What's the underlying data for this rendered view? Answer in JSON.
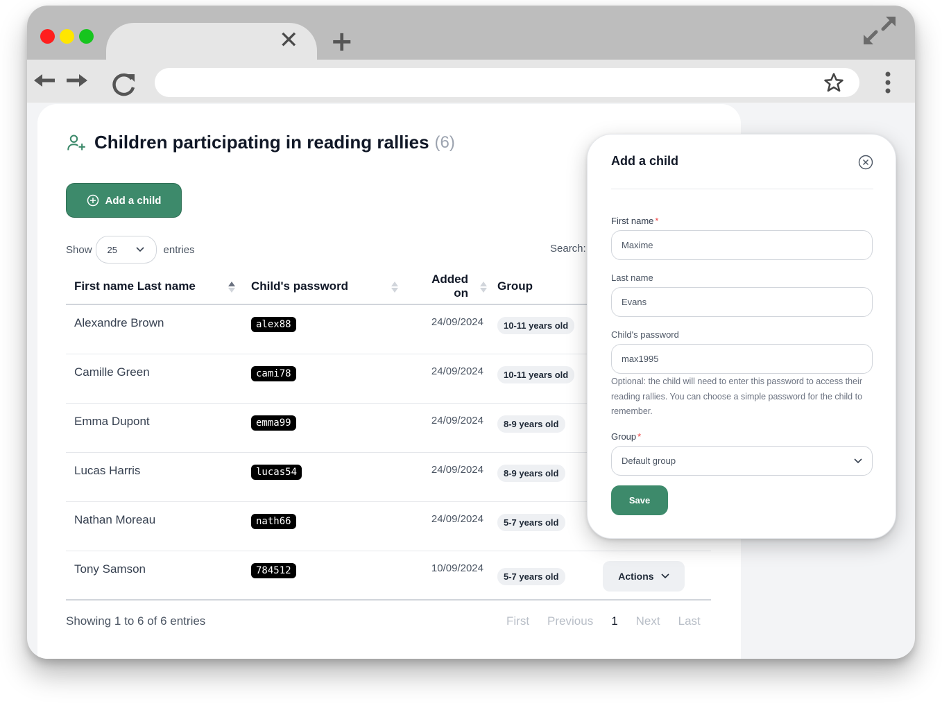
{
  "browser": {
    "tab_close_glyph": "✕",
    "tab_new_glyph": "+",
    "icons": [
      "fullscreen-icon",
      "back-arrow-icon",
      "forward-arrow-icon",
      "reload-icon",
      "star-icon",
      "kebab-menu-icon"
    ]
  },
  "page": {
    "title": "Children participating in reading rallies",
    "title_count": "(6)",
    "title_icon": "user-add-icon",
    "add_button_label": "Add a child",
    "show_label": "Show",
    "entries_value": "25",
    "entries_label": "entries",
    "search_label": "Search:"
  },
  "table": {
    "headers": [
      "First name Last name",
      "Child's password",
      "Added on",
      "Group"
    ],
    "rows": [
      {
        "name": "Alexandre Brown",
        "password": "alex88",
        "added_on": "24/09/2024",
        "group": "10-11 years old"
      },
      {
        "name": "Camille Green",
        "password": "cami78",
        "added_on": "24/09/2024",
        "group": "10-11 years old"
      },
      {
        "name": "Emma Dupont",
        "password": "emma99",
        "added_on": "24/09/2024",
        "group": "8-9 years old"
      },
      {
        "name": "Lucas Harris",
        "password": "lucas54",
        "added_on": "24/09/2024",
        "group": "8-9 years old"
      },
      {
        "name": "Nathan Moreau",
        "password": "nath66",
        "added_on": "24/09/2024",
        "group": "5-7 years old"
      },
      {
        "name": "Tony Samson",
        "password": "784512",
        "added_on": "10/09/2024",
        "group": "5-7 years old",
        "actions": "Actions"
      }
    ]
  },
  "footer": {
    "info": "Showing 1 to 6 of 6 entries",
    "first": "First",
    "previous": "Previous",
    "current_page": "1",
    "next": "Next",
    "last": "Last"
  },
  "modal": {
    "title": "Add a child",
    "first_name_label": "First name",
    "first_name_value": "Maxime",
    "last_name_label": "Last name",
    "last_name_value": "Evans",
    "password_label": "Child's password",
    "password_value": "max1995",
    "password_help": "Optional: the child will need to enter this password to access their reading rallies. You can choose a simple password for the child to remember.",
    "group_label": "Group",
    "group_value": "Default group",
    "required_mark": "*",
    "save_label": "Save"
  },
  "colors": {
    "accent": "#3d8a6b",
    "required": "#ef4444"
  }
}
